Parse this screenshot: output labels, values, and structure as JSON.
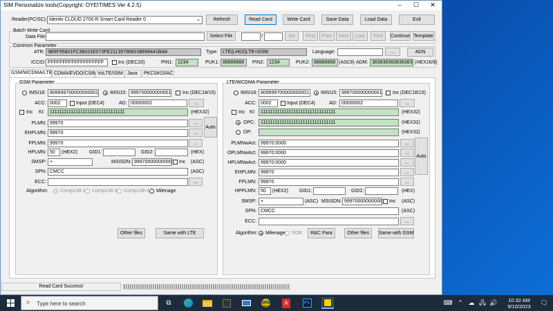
{
  "window": {
    "title": "SIM Personalize tools(Copyright: OYEITIMES Ver 4.2.5)"
  },
  "toolbar": {
    "reader_label": "Reader(PC/SC):",
    "reader_value": "Identiv CLOUD 2700 R Smart Card Reader 0",
    "refresh": "Refresh",
    "read_card": "Read Card",
    "write_card": "Write Card",
    "save_data": "Save Data",
    "load_data": "Load Data",
    "exit": "Exit"
  },
  "batch": {
    "group_title": "Batch Write Card",
    "data_file_label": "Data File:",
    "select_file": "Select File",
    "slash": "/",
    "go": "Go",
    "first": "First",
    "prev": "Prev",
    "next": "Next",
    "last": "Last",
    "find": "Find",
    "continue": "Continue",
    "template": "Template"
  },
  "common": {
    "group_title": "Common Parameter",
    "atr_label": "ATR:",
    "atr_value": "3B9F95801FC38031E073FE211357868108698441BA8",
    "type_label": "Type:",
    "type_value": "LTE(LH02)LTE+GSM",
    "language_label": "Language:",
    "language_btn": "...",
    "adn": "ADN",
    "iccid_label": "ICCID:",
    "iccid_value": "FFFFFFFFFFFFFFFFFFF",
    "inc_dec20": "Inc  (DEC20)",
    "pin1_label": "PIN1:",
    "pin1_value": "1234",
    "puk1_label": "PUK1:",
    "puk1_value": "88888888",
    "pin2_label": "PIN2:",
    "pin2_value": "1234",
    "puk2_label": "PUK2:",
    "puk2_value": "88888888",
    "asc8": "(ASC8)",
    "adm_label": "ADM:",
    "adm_value": "3838383838383838",
    "hex16": "(HEX16/8)"
  },
  "tabs": [
    "GSM/WCDMA/LTE",
    "CDMA/EVDO/CSIM",
    "VoLTE/ISIM",
    "Java",
    "PKCS#15/AC"
  ],
  "gsm": {
    "group_title": "GSM Parameter",
    "imsi18_label": "IMSI18:",
    "imsi18_value": "809999700000000001",
    "imsi15_label": "IMSI15:",
    "imsi15_value": "999700000000001",
    "inc": "Inc",
    "dec1815": "(DEC18/15)",
    "acc_label": "ACC:",
    "acc_value": "0002",
    "input_dec4": "Input (DEC4)",
    "ad_label": "AD:",
    "ad_value": "00000002",
    "ad_btn": "...",
    "ki_inc": "Inc",
    "ki_label": "KI:",
    "ki_value": "11111111111111111111111111111111",
    "hex32": "(HEX32)",
    "plmn_label": "PLMN:",
    "plmn_value": "99970",
    "ehplmn_label": "EHPLMN:",
    "ehplmn_value": "99970",
    "fplmn_label": "FPLMN:",
    "fplmn_value": "99970",
    "auto": "Auto",
    "dots": "...",
    "hplmn_label": "HPLMN:",
    "hplmn_value": "50",
    "hex2": "(HEX2)",
    "gid1_label": "GID1:",
    "gid1_value": "",
    "gid2_label": "GID2:",
    "gid2_value": "",
    "hex": "(HEX)",
    "smsp_label": "SMSP:",
    "smsp_value": "+",
    "msisdn_label": "MSISDN:",
    "msisdn_value": "9997000000000001",
    "msisdn_inc": "Inc",
    "asc": "(ASC)",
    "spn_label": "SPN:",
    "spn_value": "CMCC",
    "ecc_label": "ECC:",
    "ecc_value": "",
    "algorithm_label": "Algorithm:",
    "comp1": "Comp128-1",
    "comp2": "Comp128-2",
    "comp3": "Comp128-3",
    "milenage": "Milenage",
    "other_files": "Other files",
    "same_lte": "Same with LTE"
  },
  "lte": {
    "group_title": "LTE/WCDMA Parameter",
    "imsi18_label": "IMSI18:",
    "imsi18_value": "809999700000000001",
    "imsi15_label": "IMSI15:",
    "imsi15_value": "999700000000001",
    "inc": "Inc",
    "dec1815": "(DEC18/15)",
    "acc_label": "ACC:",
    "acc_value": "0002",
    "input_dec4": "Input (DEC4)",
    "ad_label": "AD:",
    "ad_value": "00000002",
    "ad_btn": "...",
    "ki_inc": "Inc",
    "ki_label": "KI:",
    "ki_value": "11111111111111111111111111111111",
    "hex32": "(HEX32)",
    "opc_label": "OPC:",
    "opc_value": "11111111111111111111111111111111",
    "op_label": "OP:",
    "op_value": "",
    "plmnwact_label": "PLMNwAct:",
    "plmnwact_value": "99970:0000",
    "oplmnwact_label": "OPLMNwAct:",
    "oplmnwact_value": "99970:0000",
    "hplmnwact_label": "HPLMNwAct:",
    "hplmnwact_value": "99970:0000",
    "ehplmn_label": "EHPLMN:",
    "ehplmn_value": "99970",
    "fplmn_label": "FPLMN:",
    "fplmn_value": "99970",
    "auto": "Auto",
    "dots": "...",
    "hpplmn_label": "HPPLMN:",
    "hpplmn_value": "50",
    "hex2": "(HEX2)",
    "gid1_label": "GID1:",
    "gid1_value": "",
    "gid2_label": "GID2:",
    "gid2_value": "",
    "hex": "(HEX)",
    "smsp_label": "SMSP:",
    "smsp_value": "+",
    "asc_smsp": "(ASC)",
    "msisdn_label": "MSISDN:",
    "msisdn_value": "9997000000000001",
    "msisdn_inc": "Inc",
    "asc": "(ASC)",
    "spn_label": "SPN:",
    "spn_value": "CMCC",
    "ecc_label": "ECC:",
    "ecc_value": "",
    "algorithm_label": "Algorithm:",
    "milenage": "Milenage",
    "xor": "XOR",
    "rc_para": "R&C Para",
    "other_files": "Other files",
    "same_gsm": "Same with GSM"
  },
  "status": {
    "message": "Read Card Success!",
    "progress": 1.0
  },
  "taskbar": {
    "search_placeholder": "Type here to search",
    "time": "10:32 AM",
    "date": "9/10/2023"
  }
}
